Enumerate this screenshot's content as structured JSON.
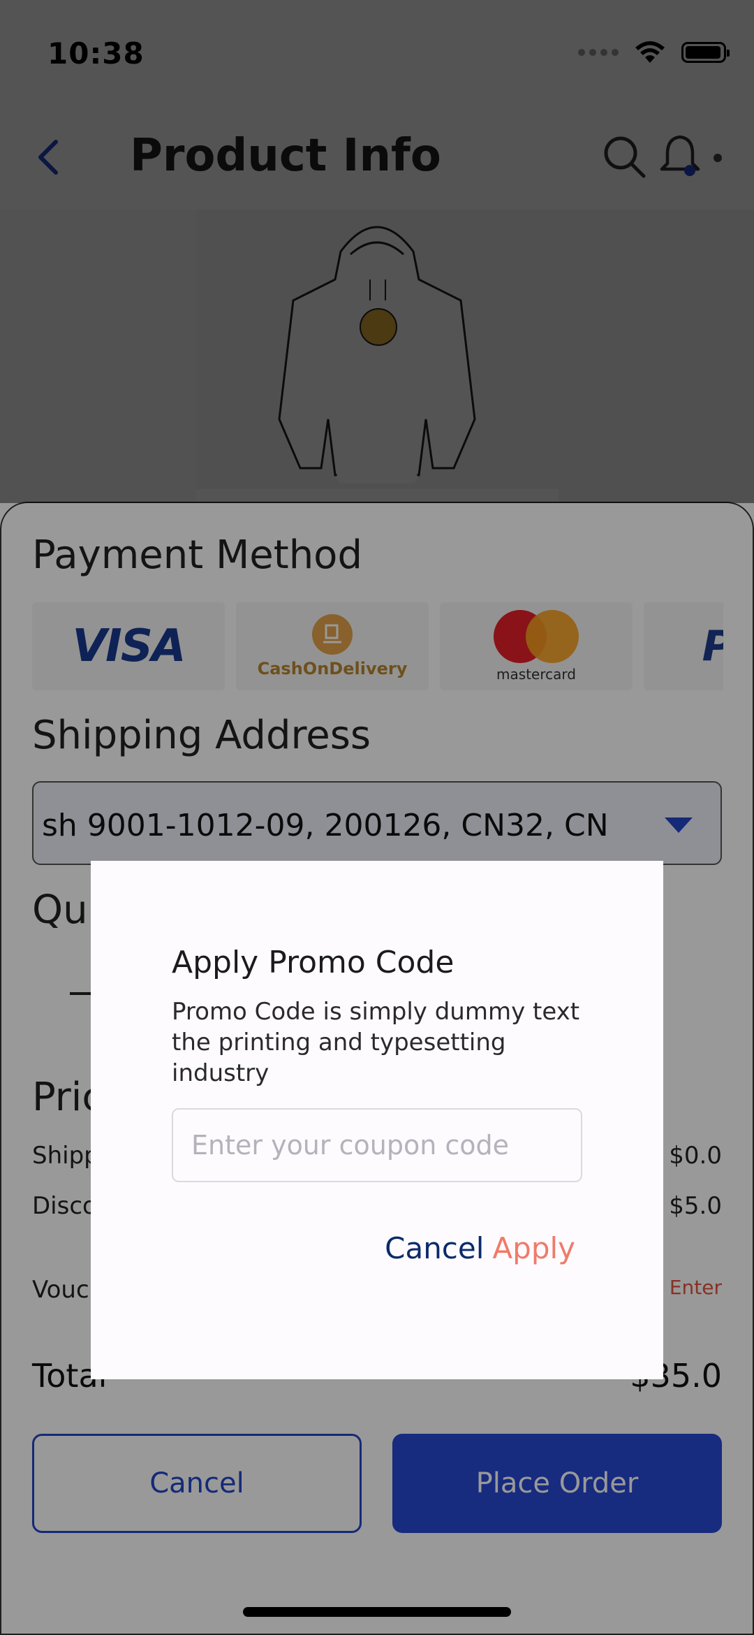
{
  "status_bar": {
    "time": "10:38"
  },
  "header": {
    "title": "Product Info"
  },
  "payment": {
    "section_title": "Payment Method",
    "methods": [
      {
        "name": "VISA"
      },
      {
        "name": "CashOnDelivery"
      },
      {
        "name": "mastercard"
      },
      {
        "name": "P P"
      }
    ]
  },
  "shipping": {
    "section_title": "Shipping Address",
    "selected_address": "sh 9001-1012-09, 200126, CN32, CN"
  },
  "quantity": {
    "section_title_partial": "Qu"
  },
  "price": {
    "section_title_partial": "Pric",
    "shipping_label_partial": "Shipp",
    "shipping_value": "$0.0",
    "discount_label_partial": "Disco",
    "discount_value": "$5.0",
    "voucher_label_partial": "Vouc",
    "voucher_action_partial": "e Enter"
  },
  "total": {
    "label": "Total",
    "value": "$35.0"
  },
  "actions": {
    "cancel_label": "Cancel",
    "place_order_label": "Place Order"
  },
  "dialog": {
    "title": "Apply Promo Code",
    "body": "Promo Code is simply dummy text the printing and typesetting industry",
    "input_placeholder": "Enter your coupon code",
    "cancel_label": "Cancel",
    "apply_label": "Apply"
  },
  "colors": {
    "primary": "#2748d4",
    "apply_accent": "#f07a6a",
    "dialog_cancel": "#0b2a6b",
    "voucher_accent": "#e0523f"
  }
}
